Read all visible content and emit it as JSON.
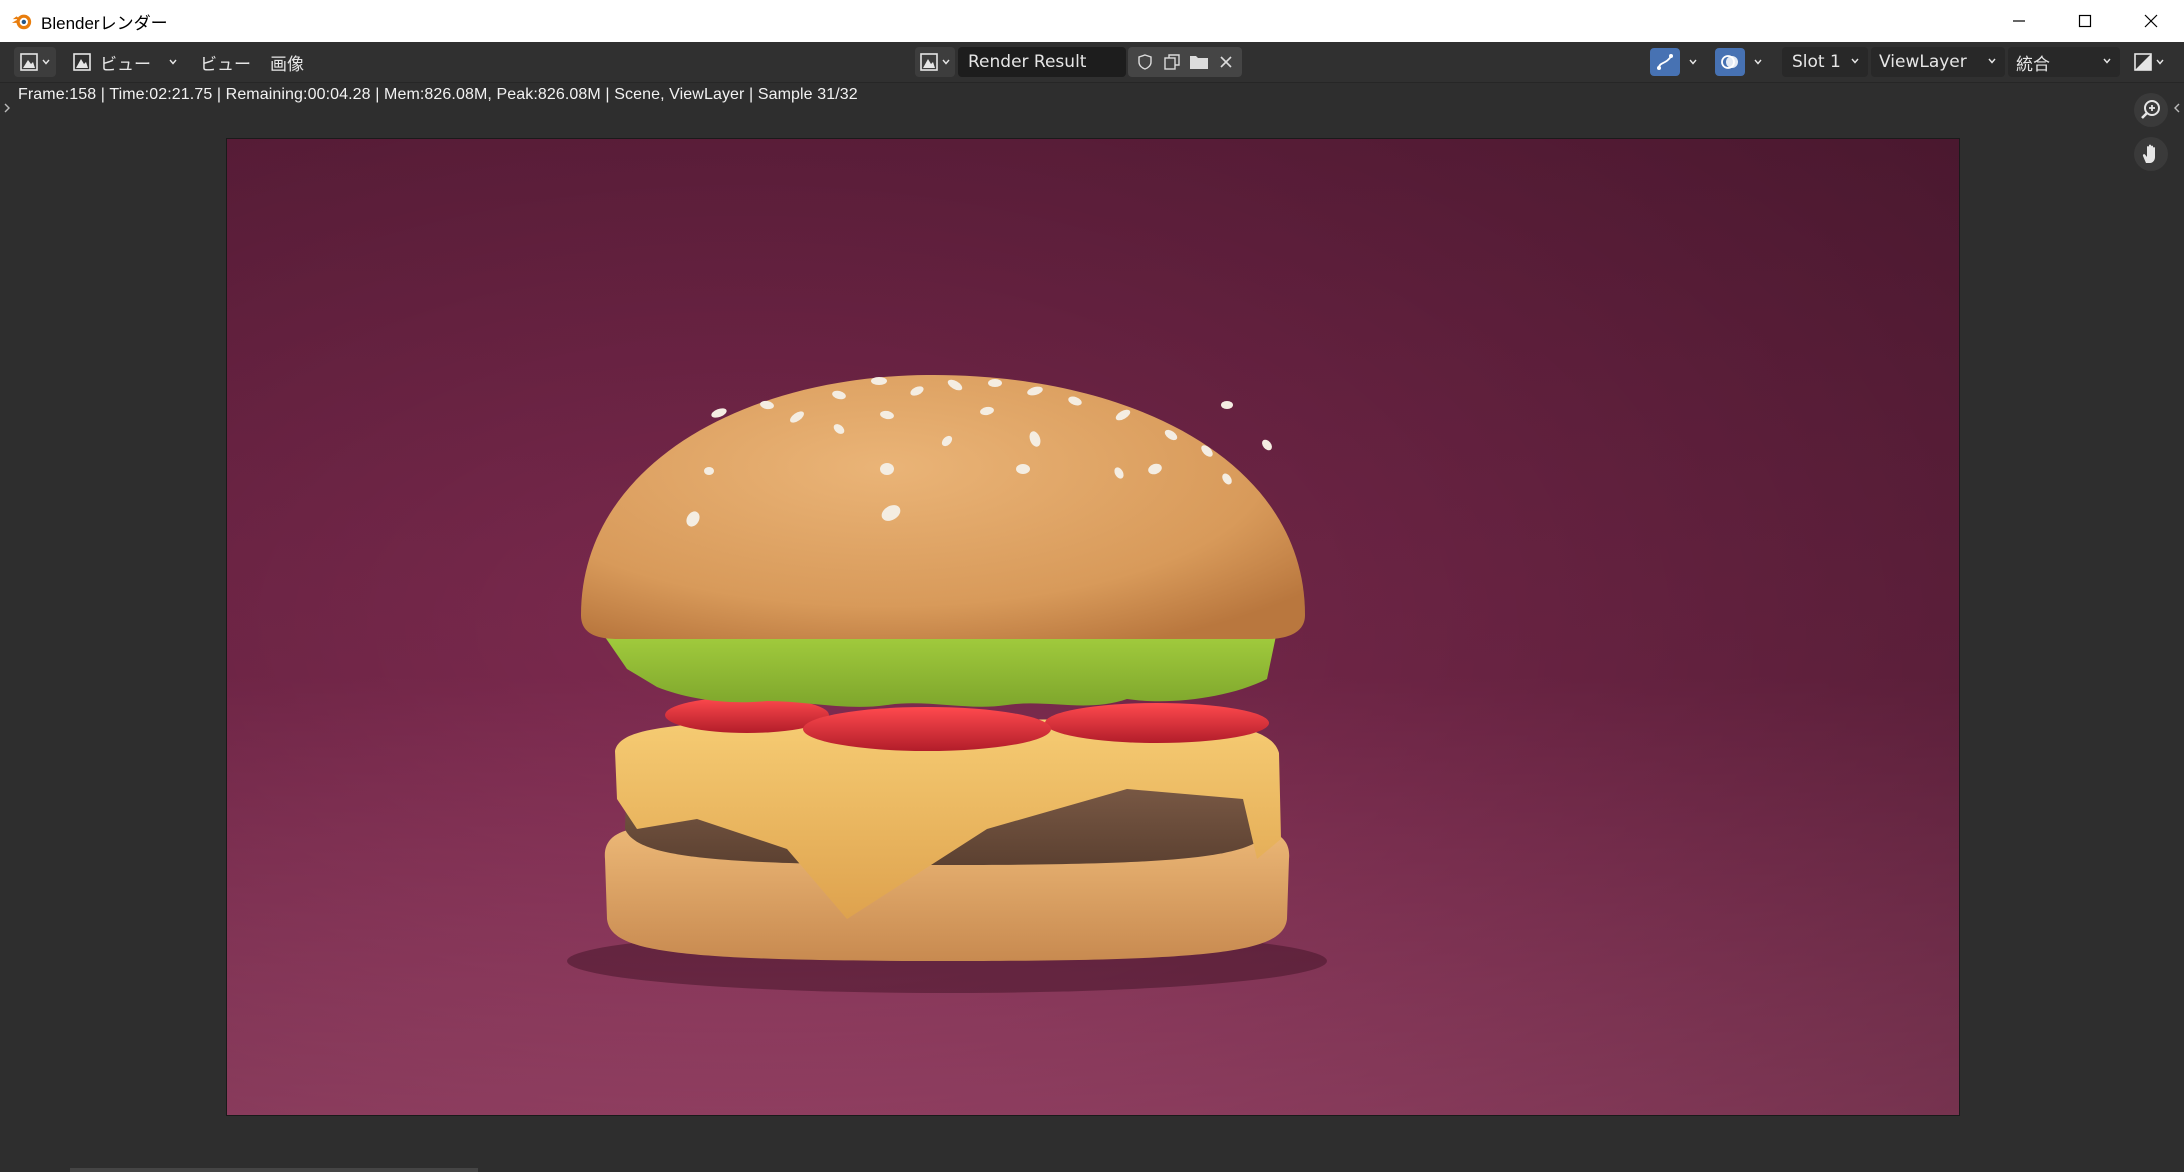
{
  "window": {
    "title": "Blenderレンダー"
  },
  "header": {
    "mode_label": "ビュー",
    "menu": [
      "ビュー",
      "画像"
    ],
    "image_name": "Render Result",
    "slot": "Slot 1",
    "view_layer": "ViewLayer",
    "pass": "統合"
  },
  "status": {
    "text": "Frame:158 | Time:02:21.75 | Remaining:00:04.28 | Mem:826.08M, Peak:826.08M | Scene, ViewLayer | Sample 31/32"
  },
  "icons": {
    "app": "blender-logo-icon",
    "zoom": "zoom-icon",
    "pan": "hand-icon"
  },
  "colors": {
    "accent_blue": "#4772b3",
    "background_pink": "#8a2f55",
    "bun": "#e2a866",
    "lettuce": "#9ac43a",
    "tomato": "#d8303a",
    "cheese": "#efbf62",
    "patty": "#7a5a44"
  }
}
